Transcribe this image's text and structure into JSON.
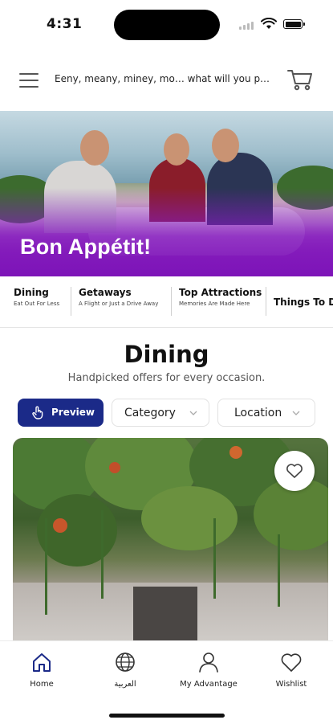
{
  "status_bar": {
    "time": "4:31"
  },
  "header": {
    "search_placeholder": "Eeny, meany, miney, mo… what will you p…",
    "menu_icon": "hamburger-menu-icon",
    "cart_icon": "shopping-cart-icon"
  },
  "hero": {
    "title": "Bon Appétit!"
  },
  "category_tabs": [
    {
      "title": "Dining",
      "subtitle": "Eat Out For Less"
    },
    {
      "title": "Getaways",
      "subtitle": "A Flight or Just a Drive Away"
    },
    {
      "title": "Top Attractions",
      "subtitle": "Memories Are Made Here"
    },
    {
      "title": "Things To D",
      "subtitle": ""
    }
  ],
  "section": {
    "title": "Dining",
    "subtitle": "Handpicked offers for every occasion."
  },
  "filters": {
    "preview_label": "Preview",
    "category_label": "Category",
    "location_label": "Location"
  },
  "card": {
    "favorite_icon": "heart-icon"
  },
  "bottom_nav": [
    {
      "label": "Home",
      "icon": "home-icon",
      "active": true
    },
    {
      "label": "العربية",
      "icon": "globe-icon",
      "active": false
    },
    {
      "label": "My Advantage",
      "icon": "user-icon",
      "active": false
    },
    {
      "label": "Wishlist",
      "icon": "heart-icon",
      "active": false
    }
  ],
  "colors": {
    "accent": "#1b2a88",
    "hero_overlay": "#7d14b8",
    "home_active": "#1b2a88"
  }
}
